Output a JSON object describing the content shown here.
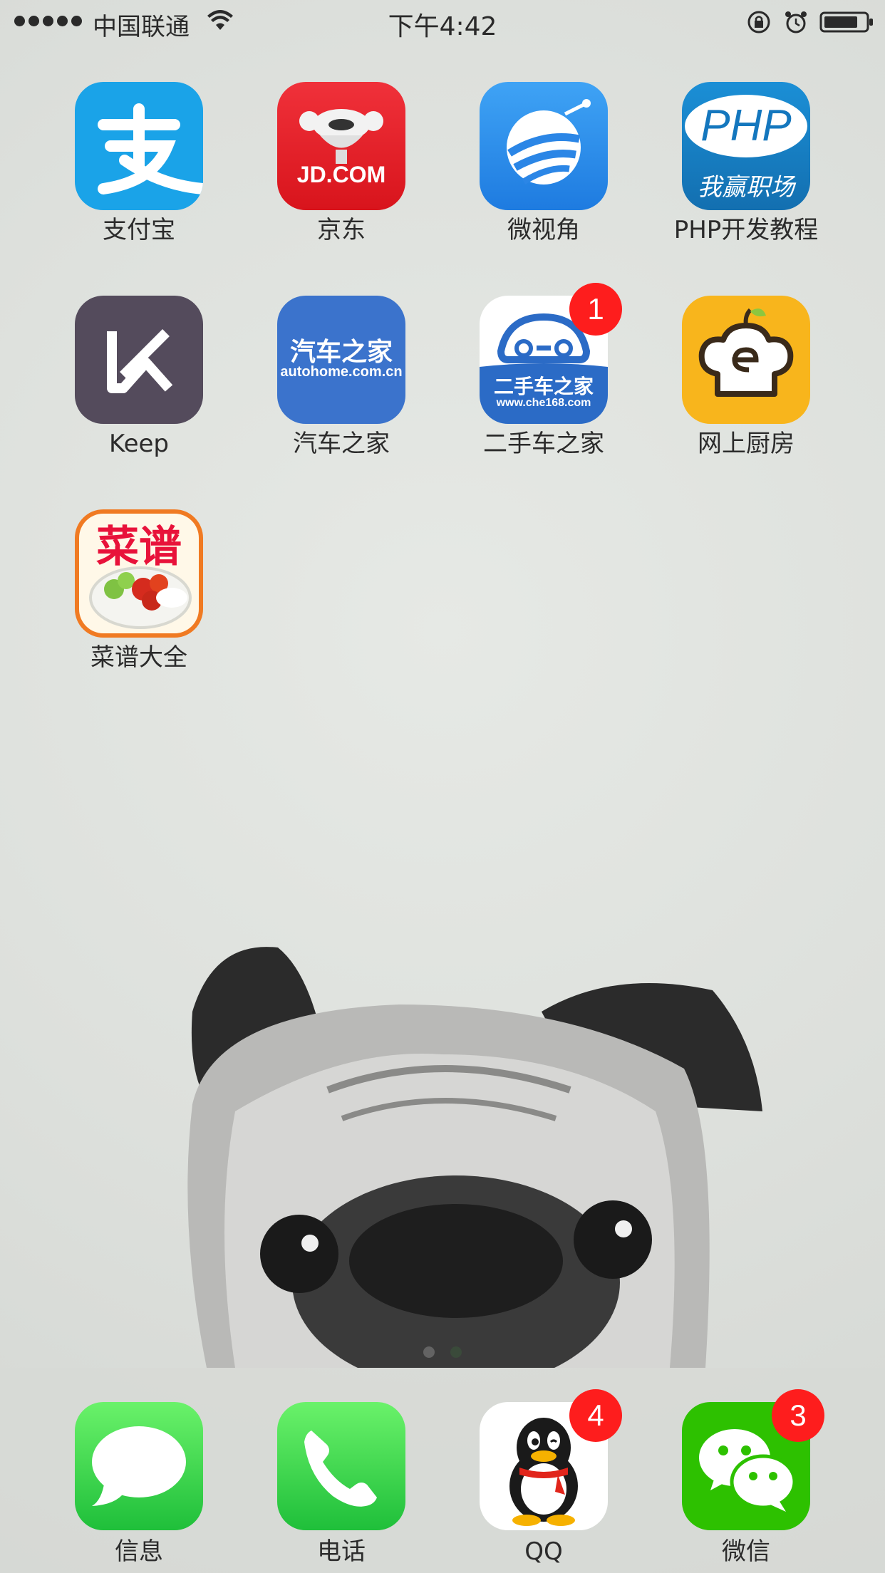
{
  "status_bar": {
    "carrier": "中国联通",
    "time": "下午4:42"
  },
  "apps": [
    {
      "label": "支付宝",
      "icon": "alipay-icon"
    },
    {
      "label": "京东",
      "icon": "jd-icon",
      "icon_text": "JD.COM"
    },
    {
      "label": "微视角",
      "icon": "weishijiao-icon"
    },
    {
      "label": "PHP开发教程",
      "icon": "php-icon",
      "icon_text": "PHP",
      "icon_subtext": "我赢职场"
    },
    {
      "label": "Keep",
      "icon": "keep-icon"
    },
    {
      "label": "汽车之家",
      "icon": "autohome-icon",
      "icon_text": "汽车之家",
      "icon_subtext": "autohome.com.cn"
    },
    {
      "label": "二手车之家",
      "icon": "che168-icon",
      "icon_text": "二手车之家",
      "icon_subtext": "www.che168.com",
      "badge": "1"
    },
    {
      "label": "网上厨房",
      "icon": "kitchen-icon"
    },
    {
      "label": "菜谱大全",
      "icon": "recipes-icon",
      "icon_text": "菜谱"
    }
  ],
  "dock": [
    {
      "label": "信息",
      "icon": "messages-icon"
    },
    {
      "label": "电话",
      "icon": "phone-icon"
    },
    {
      "label": "QQ",
      "icon": "qq-icon",
      "badge": "4"
    },
    {
      "label": "微信",
      "icon": "wechat-icon",
      "badge": "3"
    }
  ],
  "colors": {
    "badge": "#fe1d1d",
    "alipay": "#1aa3e8",
    "jd": "#e4262c",
    "keep": "#544b5c",
    "autohome": "#3b73cc",
    "kitchen": "#f8b51c",
    "messages": "#34c759",
    "wechat": "#2dc100"
  }
}
